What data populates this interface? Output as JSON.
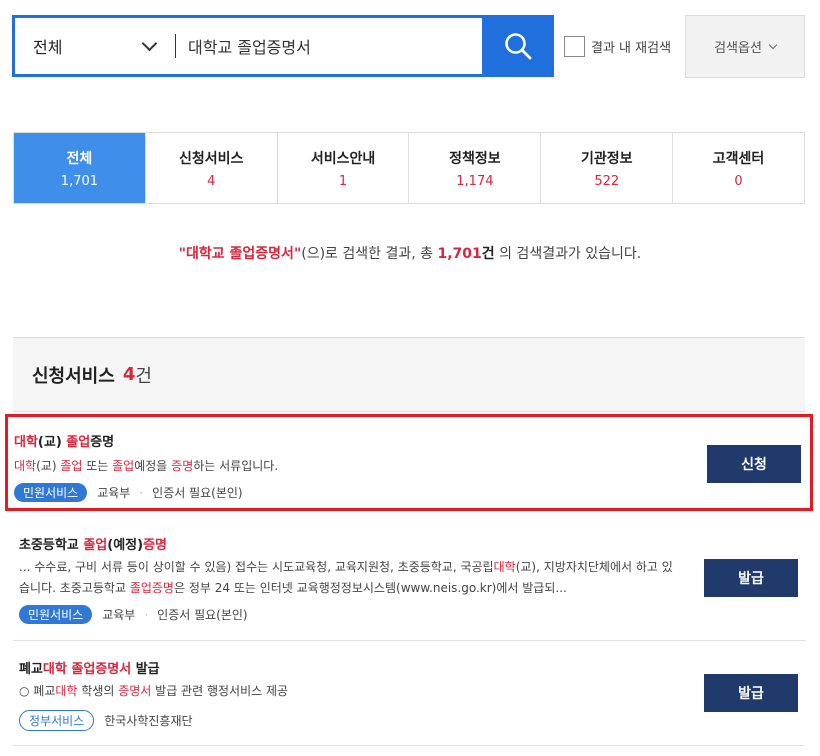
{
  "search": {
    "scope": "전체",
    "query": "대학교 졸업증명서",
    "recheck_label": "결과 내 재검색",
    "options_label": "검색옵션"
  },
  "tabs": [
    {
      "label": "전체",
      "count": "1,701",
      "active": true
    },
    {
      "label": "신청서비스",
      "count": "4"
    },
    {
      "label": "서비스안내",
      "count": "1"
    },
    {
      "label": "정책정보",
      "count": "1,174"
    },
    {
      "label": "기관정보",
      "count": "522"
    },
    {
      "label": "고객센터",
      "count": "0"
    }
  ],
  "summary": {
    "keyword": "\"대학교 졸업증명서\"",
    "text1": "(으)로 검색한 결과, 총 ",
    "total": "1,701",
    "unit": "건",
    "text2": " 의 검색결과가 있습니다."
  },
  "section": {
    "title": "신청서비스",
    "count": "4",
    "unit": "건"
  },
  "items": [
    {
      "title": [
        {
          "t": "대학",
          "h": true
        },
        {
          "t": "(교) "
        },
        {
          "t": "졸업",
          "h": true
        },
        {
          "t": "증명"
        }
      ],
      "desc": [
        {
          "t": "대학",
          "h": true
        },
        {
          "t": "(교) "
        },
        {
          "t": "졸업",
          "h": true
        },
        {
          "t": " 또는 "
        },
        {
          "t": "졸업",
          "h": true
        },
        {
          "t": "예정을 "
        },
        {
          "t": "증명",
          "h": true
        },
        {
          "t": "하는 서류입니다."
        }
      ],
      "badge": "민원서비스",
      "agency": "교육부",
      "cert": "인증서 필요(본인)",
      "button": "신청"
    },
    {
      "title": [
        {
          "t": "초중등학교 "
        },
        {
          "t": "졸업",
          "h": true
        },
        {
          "t": "(예정)"
        },
        {
          "t": "증명",
          "h": true
        }
      ],
      "desc": [
        {
          "t": "... 수수료, 구비 서류 등이 상이할 수 있음) 접수는 시도교육청, 교육지원청, 초중등학교, 국공립"
        },
        {
          "t": "대학",
          "h": true
        },
        {
          "t": "(교), 지방자치단체에서 하고 있습니다. 초중고등학교 "
        },
        {
          "t": "졸업증명",
          "h": true
        },
        {
          "t": "은 정부 24 또는 인터넷 교육행정정보시스템(www.neis.go.kr)에서 발급되..."
        }
      ],
      "badge": "민원서비스",
      "agency": "교육부",
      "cert": "인증서 필요(본인)",
      "button": "발급"
    },
    {
      "title": [
        {
          "t": "폐교"
        },
        {
          "t": "대학",
          "h": true
        },
        {
          "t": " "
        },
        {
          "t": "졸업증명서",
          "h": true
        },
        {
          "t": " 발급"
        }
      ],
      "desc": [
        {
          "t": "○ 폐교"
        },
        {
          "t": "대학",
          "h": true
        },
        {
          "t": " 학생의 "
        },
        {
          "t": "증명서",
          "h": true
        },
        {
          "t": " 발급 관련 행정서비스 제공"
        }
      ],
      "badge": "정부서비스",
      "agency": "한국사학진흥재단",
      "button": "발급"
    }
  ],
  "colors": {
    "accent": "#1f6fdd",
    "highlight": "#d7263d",
    "button": "#1f3a6b",
    "selected_box": "#e31b23"
  }
}
